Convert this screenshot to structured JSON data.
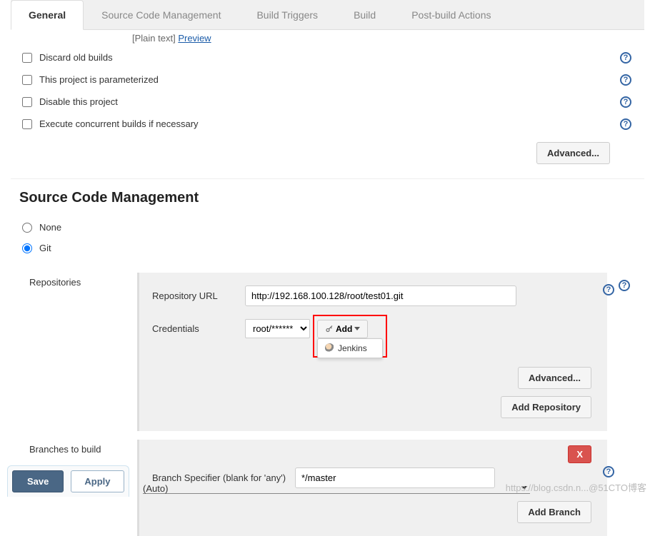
{
  "tabs": {
    "general": "General",
    "scm": "Source Code Management",
    "triggers": "Build Triggers",
    "build": "Build",
    "post": "Post-build Actions"
  },
  "plaintext": {
    "label": "[Plain text]",
    "preview": "Preview"
  },
  "options": {
    "discard": "Discard old builds",
    "param": "This project is parameterized",
    "disable": "Disable this project",
    "concurrent": "Execute concurrent builds if necessary"
  },
  "buttons": {
    "advanced": "Advanced...",
    "add": "Add",
    "add_repo": "Add Repository",
    "add_branch": "Add Branch",
    "save": "Save",
    "apply": "Apply",
    "delete": "X"
  },
  "scm": {
    "title": "Source Code Management",
    "none": "None",
    "git": "Git",
    "repositories_label": "Repositories",
    "repo_url_label": "Repository URL",
    "repo_url_value": "http://192.168.100.128/root/test01.git",
    "credentials_label": "Credentials",
    "credentials_value": "root/******",
    "jenkins_option": "Jenkins",
    "branches_label": "Branches to build",
    "branch_spec_label": "Branch Specifier (blank for 'any')",
    "branch_spec_value": "*/master"
  },
  "footer": {
    "auto": "(Auto)"
  },
  "watermark": {
    "left": "https://blog.csdn.n",
    "right": "@51CTO博客"
  }
}
